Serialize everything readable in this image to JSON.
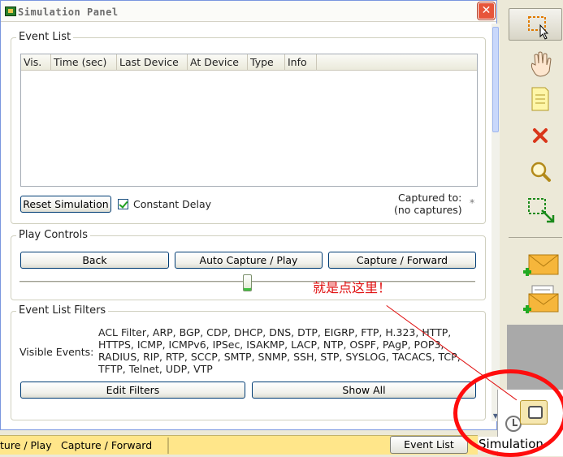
{
  "window": {
    "title": "Simulation Panel",
    "close_glyph": "✕"
  },
  "event_list": {
    "legend": "Event List",
    "columns": [
      "Vis.",
      "Time (sec)",
      "Last Device",
      "At Device",
      "Type",
      "Info"
    ],
    "reset_label": "Reset Simulation",
    "constant_delay_label": "Constant Delay",
    "constant_delay_checked": true,
    "captured_label": "Captured to:",
    "captured_value": "(no captures)",
    "asterisk": "*"
  },
  "play_controls": {
    "legend": "Play Controls",
    "back_label": "Back",
    "auto_label": "Auto Capture / Play",
    "forward_label": "Capture / Forward",
    "speed_fraction": 0.5
  },
  "filters": {
    "legend": "Event List Filters",
    "visible_label": "Visible Events:",
    "visible_events": "ACL Filter, ARP, BGP, CDP, DHCP, DNS, DTP, EIGRP, FTP, H.323, HTTP, HTTPS, ICMP, ICMPv6, IPSec, ISAKMP, LACP, NTP, OSPF, PAgP, POP3, RADIUS, RIP, RTP, SCCP, SMTP, SNMP, SSH, STP, SYSLOG, TACACS, TCP, TFTP, Telnet, UDP, VTP",
    "edit_label": "Edit Filters",
    "show_all_label": "Show All"
  },
  "toolbar": {
    "tools": [
      "select-tool",
      "move-layout-tool",
      "place-note-tool",
      "delete-tool",
      "inspect-tool",
      "resize-shape-tool",
      "add-simple-pdu-tool",
      "add-complex-pdu-tool"
    ],
    "active": "select-tool"
  },
  "annotation": {
    "text": "就是点这里！"
  },
  "status_bar": {
    "left_text": "ture / Play",
    "middle_text": "Capture / Forward",
    "event_list_button": "Event List"
  },
  "simulation_tab": {
    "label": "Simulation"
  },
  "colors": {
    "status_bar": "#ffe68a",
    "annotation": "#e01010",
    "close_button": "#e7553a"
  }
}
